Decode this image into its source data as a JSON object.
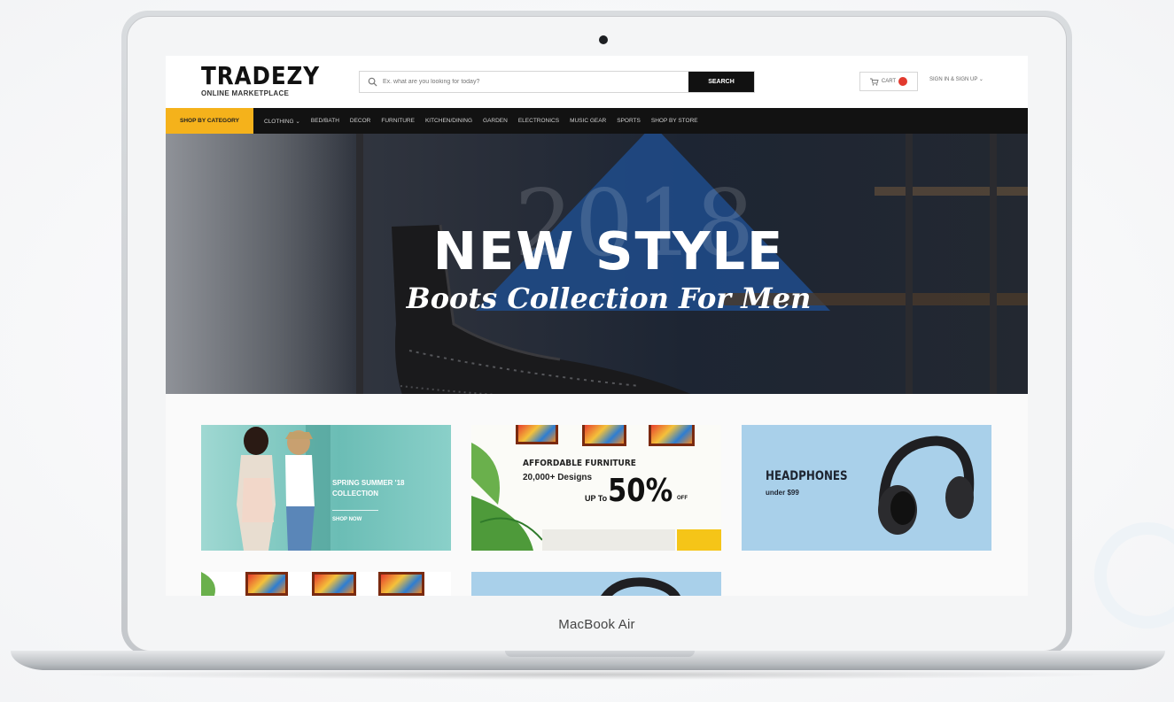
{
  "device": {
    "label": "MacBook Air"
  },
  "header": {
    "logo_main": "TRADEZY",
    "logo_sub": "ONLINE MARKETPLACE",
    "search_placeholder": "Ex. what are you looking for today?",
    "search_button": "SEARCH",
    "cart_label": "CART",
    "signin_label": "SIGN IN & SIGN UP"
  },
  "nav": {
    "category": "SHOP BY CATEGORY",
    "items": [
      "CLOTHING",
      "BED/BATH",
      "DECOR",
      "FURNITURE",
      "KITCHEN/DINING",
      "GARDEN",
      "ELECTRONICS",
      "MUSIC GEAR",
      "SPORTS",
      "SHOP BY STORE"
    ]
  },
  "hero": {
    "year": "2018",
    "title": "NEW STYLE",
    "subtitle": "Boots Collection For Men"
  },
  "promos": {
    "spring": {
      "line1": "SPRING SUMMER '18",
      "line2": "COLLECTION",
      "cta": "SHOP NOW"
    },
    "furniture": {
      "title": "AFFORDABLE FURNITURE",
      "sub": "20,000+ Designs",
      "upto": "UP To",
      "percent": "50%",
      "off": "OFF"
    },
    "headphones": {
      "title": "HEADPHONES",
      "sub": "under $99"
    }
  },
  "colors": {
    "accent": "#f5b21b",
    "nav_bg": "#121212",
    "cart_badge": "#e23a2e"
  }
}
